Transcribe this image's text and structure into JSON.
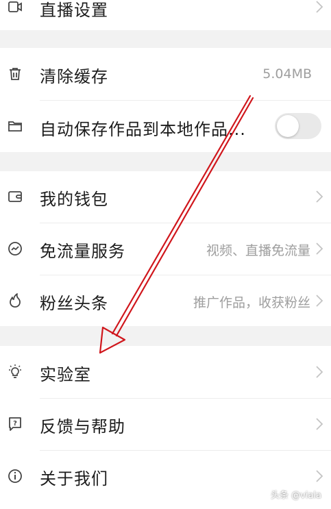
{
  "settings": {
    "live_settings_label": "直播设置",
    "clear_cache_label": "清除缓存",
    "clear_cache_value": "5.04MB",
    "auto_save_label": "自动保存作品到本地作品...",
    "auto_save_enabled": false,
    "wallet_label": "我的钱包",
    "free_data_label": "免流量服务",
    "free_data_value": "视频、直播免流量",
    "fans_headline_label": "粉丝头条",
    "fans_headline_value": "推广作品，收获粉丝",
    "lab_label": "实验室",
    "feedback_label": "反馈与帮助",
    "about_label": "关于我们"
  },
  "icons": {
    "live_settings": "live-camera-icon",
    "clear_cache": "trash-icon",
    "auto_save": "folder-icon",
    "wallet": "wallet-icon",
    "free_data": "data-trend-icon",
    "fans_headline": "flame-icon",
    "lab": "lightbulb-icon",
    "feedback": "feedback-question-icon",
    "about": "info-icon",
    "chevron": "chevron-right-icon"
  },
  "colors": {
    "background": "#f2f2f2",
    "annotation_arrow": "#d0161c"
  },
  "watermark": "头条 @viala"
}
